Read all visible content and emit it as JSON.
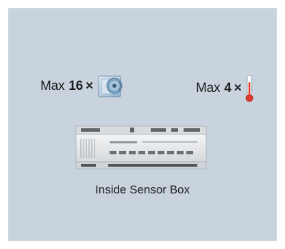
{
  "specs": {
    "left": {
      "prefix": "Max",
      "count": "16",
      "times": "×",
      "icon": "room-sensor-icon"
    },
    "right": {
      "prefix": "Max",
      "count": "4",
      "times": "×",
      "icon": "thermometer-icon"
    }
  },
  "device": {
    "icon": "din-rail-controller-icon"
  },
  "caption": "Inside Sensor Box",
  "colors": {
    "panel": "#c9d3dd",
    "text": "#1d1d1d",
    "thermometer": "#e23a2a",
    "sensor": "#7fa7c8"
  }
}
